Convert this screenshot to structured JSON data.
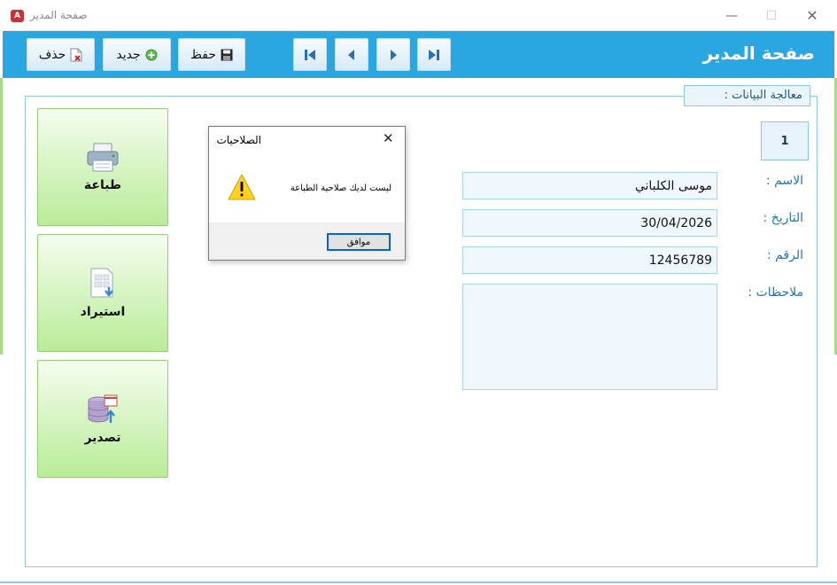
{
  "window": {
    "title": "صفحة المدير",
    "app_icon_text": "A",
    "minimize_glyph": "—",
    "maximize_glyph": "☐",
    "close_glyph": "✕"
  },
  "header": {
    "title": "صفحة المدير",
    "background_color": "#2aa7e0",
    "buttons": {
      "delete_label": "حذف",
      "new_label": "جديد",
      "save_label": "حفظ"
    },
    "nav_icons": [
      "first-record-icon",
      "previous-record-icon",
      "next-record-icon",
      "last-record-icon"
    ]
  },
  "panel": {
    "legend": "معالجة البيانات :"
  },
  "tiles": {
    "print_label": "طباعة",
    "import_label": "استيراد",
    "export_label": "تصدير"
  },
  "form": {
    "record_id": "1",
    "name_label": "الاسم :",
    "name_value": "موسى الكلباني",
    "date_label": "التاريخ :",
    "date_value": "30/04/2026",
    "number_label": "الرقم :",
    "number_value": "12456789",
    "notes_label": "ملاحظات :",
    "notes_value": ""
  },
  "dialog": {
    "title": "الصلاحيات",
    "message": "ليست لديك صلاحية الطباعة",
    "ok_label": "موافق",
    "icon": "warning-icon"
  }
}
